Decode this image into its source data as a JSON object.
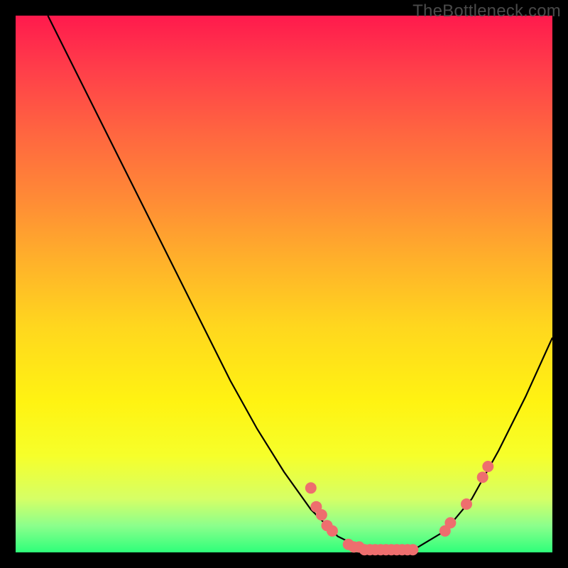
{
  "watermark": "TheBottleneck.com",
  "chart_data": {
    "type": "line",
    "title": "",
    "xlabel": "",
    "ylabel": "",
    "xlim": [
      0,
      100
    ],
    "ylim": [
      0,
      100
    ],
    "curve": [
      {
        "x": 6,
        "y": 100
      },
      {
        "x": 10,
        "y": 92
      },
      {
        "x": 15,
        "y": 82
      },
      {
        "x": 20,
        "y": 72
      },
      {
        "x": 25,
        "y": 62
      },
      {
        "x": 30,
        "y": 52
      },
      {
        "x": 35,
        "y": 42
      },
      {
        "x": 40,
        "y": 32
      },
      {
        "x": 45,
        "y": 23
      },
      {
        "x": 50,
        "y": 15
      },
      {
        "x": 55,
        "y": 8
      },
      {
        "x": 60,
        "y": 3
      },
      {
        "x": 65,
        "y": 0.5
      },
      {
        "x": 70,
        "y": 0
      },
      {
        "x": 75,
        "y": 1
      },
      {
        "x": 80,
        "y": 4
      },
      {
        "x": 85,
        "y": 10
      },
      {
        "x": 90,
        "y": 19
      },
      {
        "x": 95,
        "y": 29
      },
      {
        "x": 100,
        "y": 40
      }
    ],
    "markers": [
      {
        "x": 55,
        "y": 12
      },
      {
        "x": 56,
        "y": 8.5
      },
      {
        "x": 57,
        "y": 7
      },
      {
        "x": 58,
        "y": 5
      },
      {
        "x": 59,
        "y": 4
      },
      {
        "x": 62,
        "y": 1.5
      },
      {
        "x": 63,
        "y": 1
      },
      {
        "x": 64,
        "y": 1
      },
      {
        "x": 65,
        "y": 0.5
      },
      {
        "x": 66,
        "y": 0.5
      },
      {
        "x": 67,
        "y": 0.5
      },
      {
        "x": 68,
        "y": 0.5
      },
      {
        "x": 69,
        "y": 0.5
      },
      {
        "x": 70,
        "y": 0.5
      },
      {
        "x": 71,
        "y": 0.5
      },
      {
        "x": 72,
        "y": 0.5
      },
      {
        "x": 73,
        "y": 0.5
      },
      {
        "x": 74,
        "y": 0.5
      },
      {
        "x": 80,
        "y": 4
      },
      {
        "x": 81,
        "y": 5.5
      },
      {
        "x": 84,
        "y": 9
      },
      {
        "x": 87,
        "y": 14
      },
      {
        "x": 88,
        "y": 16
      }
    ],
    "marker_color": "#ee6e6e",
    "marker_radius_px": 8
  }
}
